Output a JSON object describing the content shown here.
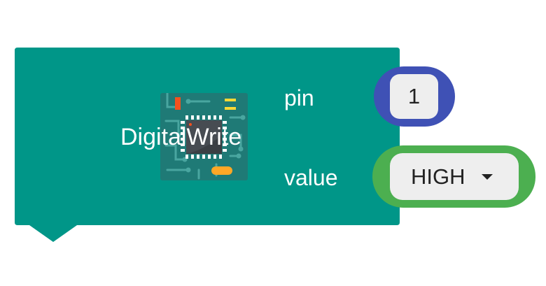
{
  "block": {
    "title": "DigitalWrite",
    "color": "#009688",
    "icon": "circuit-board-chip-icon"
  },
  "inputs": {
    "pin": {
      "label": "pin",
      "value": "1",
      "socket_color": "#3f51b5"
    },
    "value": {
      "label": "value",
      "selected": "HIGH",
      "socket_color": "#4caf50"
    }
  }
}
